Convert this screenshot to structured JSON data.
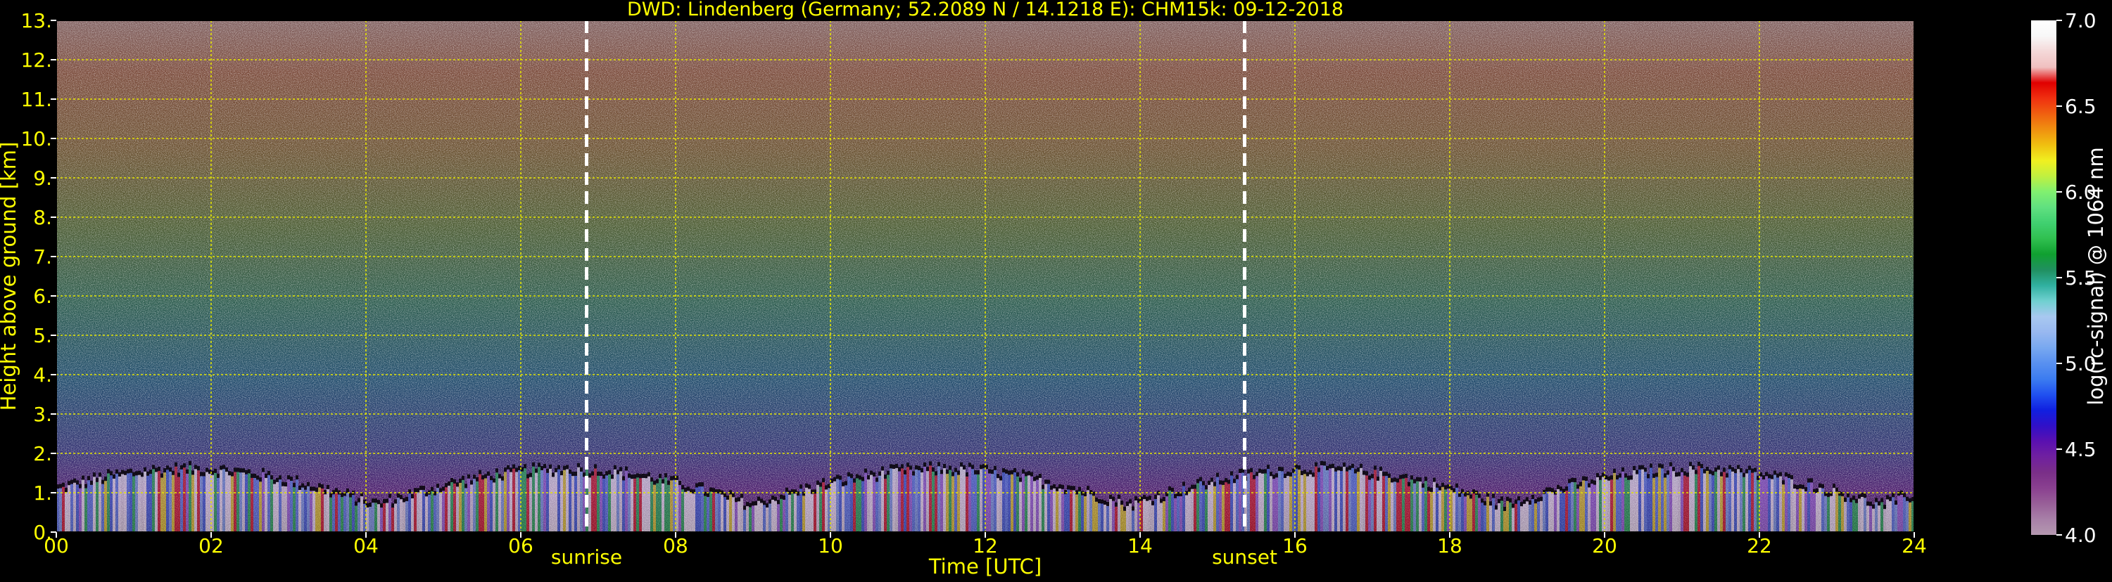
{
  "chart_data": {
    "type": "heatmap",
    "title": "DWD: Lindenberg (Germany; 52.2089 N / 14.1218 E):     CHM15k: 09-12-2018",
    "xlabel": "Time [UTC]",
    "ylabel": "Height above ground [km]",
    "xlim": [
      0,
      24
    ],
    "ylim": [
      0,
      13
    ],
    "x_ticks": [
      0,
      2,
      4,
      6,
      8,
      10,
      12,
      14,
      16,
      18,
      20,
      22,
      24
    ],
    "x_tick_labels": [
      "00",
      "02",
      "04",
      "06",
      "08",
      "10",
      "12",
      "14",
      "16",
      "18",
      "20",
      "22",
      "24"
    ],
    "y_ticks": [
      0,
      1,
      2,
      3,
      4,
      5,
      6,
      7,
      8,
      9,
      10,
      11,
      12,
      13
    ],
    "y_tick_labels": [
      "0.",
      "1.",
      "2.",
      "3.",
      "4.",
      "5.",
      "6.",
      "7.",
      "8.",
      "9.",
      "10.",
      "11.",
      "12.",
      "13."
    ],
    "grid": true,
    "grid_color": "#e6e600",
    "annotations": [
      {
        "label": "sunrise",
        "x": 6.85
      },
      {
        "label": "sunset",
        "x": 15.35
      }
    ],
    "colorbar": {
      "label": "log(rc-signal) @ 1064 nm",
      "range": [
        4.0,
        7.0
      ],
      "ticks": [
        4.0,
        4.5,
        5.0,
        5.5,
        6.0,
        6.5,
        7.0
      ],
      "tick_labels": [
        "4.0",
        "4.5",
        "5.0",
        "5.5",
        "6.0",
        "6.5",
        "7.0"
      ],
      "colors": [
        "#b498b0",
        "#a880a8",
        "#985f98",
        "#8a4090",
        "#7a2f88",
        "#7020a0",
        "#5a10b0",
        "#3010c8",
        "#1020e0",
        "#2050f0",
        "#3c7cf0",
        "#5890f0",
        "#78a8f0",
        "#98b8f0",
        "#a8c8f0",
        "#70d0d0",
        "#30b0a0",
        "#209060",
        "#10a030",
        "#30c050",
        "#40d070",
        "#60e080",
        "#80f070",
        "#c0f040",
        "#f0f020",
        "#f0c010",
        "#f09010",
        "#f06010",
        "#f03010",
        "#e00000",
        "#f0c0c0",
        "#f4d8d8",
        "#f8f8f8",
        "#ffffff"
      ]
    },
    "text_color": "#ffff00"
  }
}
